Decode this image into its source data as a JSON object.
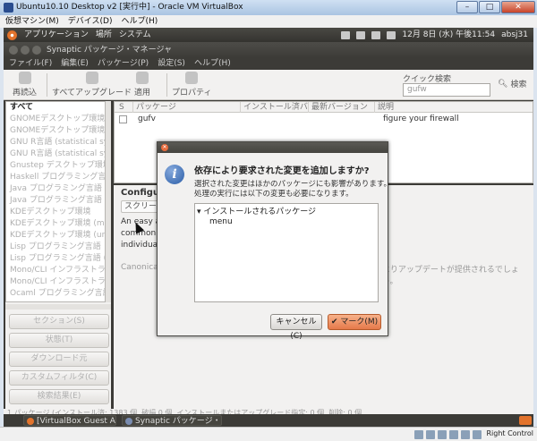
{
  "vbox": {
    "title": "Ubuntu10.10 Desktop v2 [実行中] - Oracle VM VirtualBox",
    "menu": [
      "仮想マシン(M)",
      "デバイス(D)",
      "ヘルプ(H)"
    ],
    "host_key": "Right Control"
  },
  "gnome_panel": {
    "menus": [
      "アプリケーション",
      "場所",
      "システム"
    ],
    "clock": "12月 8日 (水) 午後11:54",
    "user": "absj31"
  },
  "synaptic": {
    "title": "Synaptic パッケージ・マネージャ",
    "menu": [
      "ファイル(F)",
      "編集(E)",
      "パッケージ(P)",
      "設定(S)",
      "ヘルプ(H)"
    ],
    "toolbar": {
      "reload": "再読込",
      "upgrade_all": "すべてアップグレード",
      "apply": "適用",
      "properties": "プロパティ",
      "quick_search_label": "クイック検索",
      "quick_search_value": "gufw",
      "search": "検索"
    },
    "categories": [
      "すべて",
      "GNOMEデスクトップ環境",
      "GNOMEデスクトップ環境 (un",
      "GNU R言語 (statistical syst",
      "GNU R言語 (statistical syst",
      "Gnustep デスクトップ環境 (u",
      "Haskell プログラミング言語",
      "Java プログラミング言語",
      "Java プログラミング言語 (un",
      "KDEデスクトップ環境",
      "KDEデスクトップ環境 (multi",
      "KDEデスクトップ環境 (unive",
      "Lisp プログラミング言語",
      "Lisp プログラミング言語 (uni",
      "Mono/CLI インフラストラク",
      "Mono/CLI インフラストラク",
      "Ocaml プログラミング言語"
    ],
    "side_buttons": [
      "セクション(S)",
      "状態(T)",
      "ダウンロード元",
      "カスタムフィルタ(C)",
      "検索結果(E)"
    ],
    "table_headers": [
      "S",
      "パッケージ",
      "インストール済バ",
      "最新バージョン",
      "説明"
    ],
    "row": {
      "package": "gufv",
      "description": "figure your firewall"
    },
    "desc": {
      "title": "Configu",
      "tab": "スクリーン",
      "lines": [
        "An easy a",
        "common",
        "individua"
      ],
      "canonical": "Canonica",
      "update_note": "よりアップデートが提供されるでしょう。"
    },
    "status_bar": "1 パッケージ (インストール済: 1383 個, 破損 0 個, インストールまたはアップグレード指定: 0 個, 削除: 0 個"
  },
  "taskbar": [
    "[VirtualBox Guest A...",
    "Synaptic パッケージ・..."
  ],
  "dialog": {
    "heading": "依存により要求された変更を追加しますか?",
    "text_line1": "選択された変更はほかのパッケージにも影響があります。",
    "text_line2": "処理の実行には以下の変更も必要になります。",
    "tree_header": "インストールされるパッケージ",
    "tree_items": [
      "menu"
    ],
    "cancel": "キャンセル(C)",
    "mark": "マーク(M)"
  }
}
